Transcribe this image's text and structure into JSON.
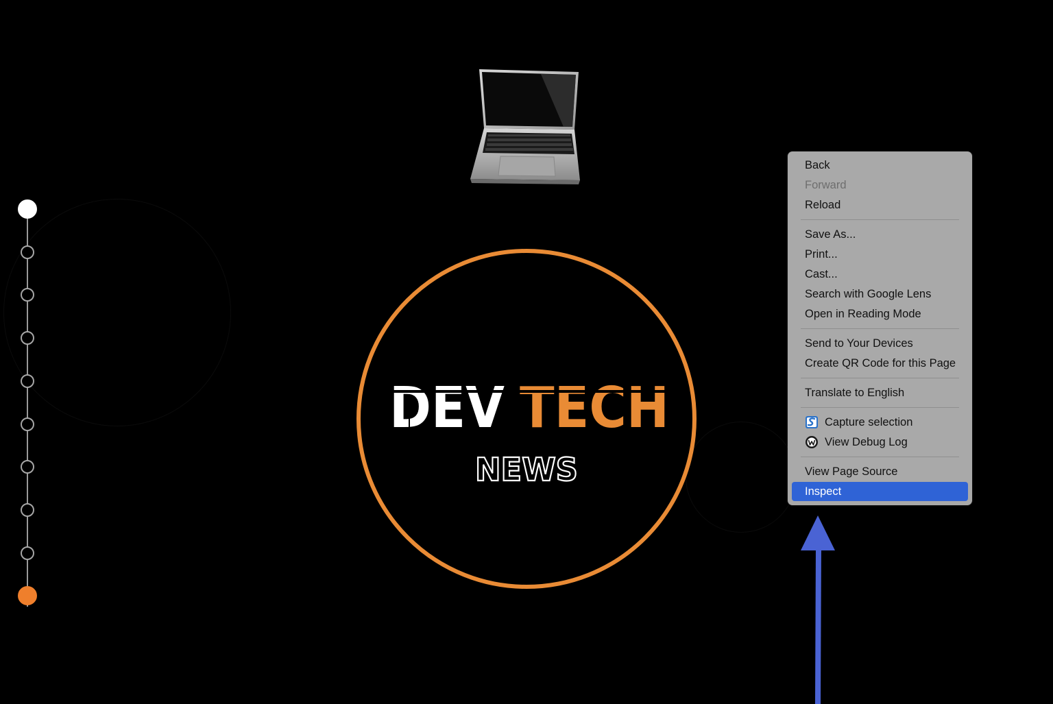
{
  "logo": {
    "word_dev": "DEV",
    "word_tech": "TECH",
    "word_news": "NEWS",
    "ring_color": "#e98b35",
    "tech_color": "#e98b35",
    "text_color": "#ffffff"
  },
  "timeline": {
    "dots": [
      {
        "state": "active"
      },
      {
        "state": "inactive"
      },
      {
        "state": "inactive"
      },
      {
        "state": "inactive"
      },
      {
        "state": "inactive"
      },
      {
        "state": "inactive"
      },
      {
        "state": "inactive"
      },
      {
        "state": "inactive"
      },
      {
        "state": "inactive"
      },
      {
        "state": "current"
      }
    ],
    "active_color": "#ffffff",
    "current_color": "#ef7f2c"
  },
  "context_menu": {
    "groups": [
      [
        {
          "label": "Back",
          "disabled": false
        },
        {
          "label": "Forward",
          "disabled": true
        },
        {
          "label": "Reload",
          "disabled": false
        }
      ],
      [
        {
          "label": "Save As..."
        },
        {
          "label": "Print..."
        },
        {
          "label": "Cast..."
        },
        {
          "label": "Search with Google Lens"
        },
        {
          "label": "Open in Reading Mode"
        }
      ],
      [
        {
          "label": "Send to Your Devices"
        },
        {
          "label": "Create QR Code for this Page"
        }
      ],
      [
        {
          "label": "Translate to English"
        }
      ],
      [
        {
          "label": "Capture selection",
          "icon": "snagit-icon"
        },
        {
          "label": "View Debug Log",
          "icon": "debug-log-icon"
        }
      ],
      [
        {
          "label": "View Page Source"
        },
        {
          "label": "Inspect",
          "highlighted": true
        }
      ]
    ],
    "highlight_color": "#2f63d6"
  },
  "annotation": {
    "arrow_color": "#4a63d4",
    "icon": "up-arrow-icon"
  }
}
